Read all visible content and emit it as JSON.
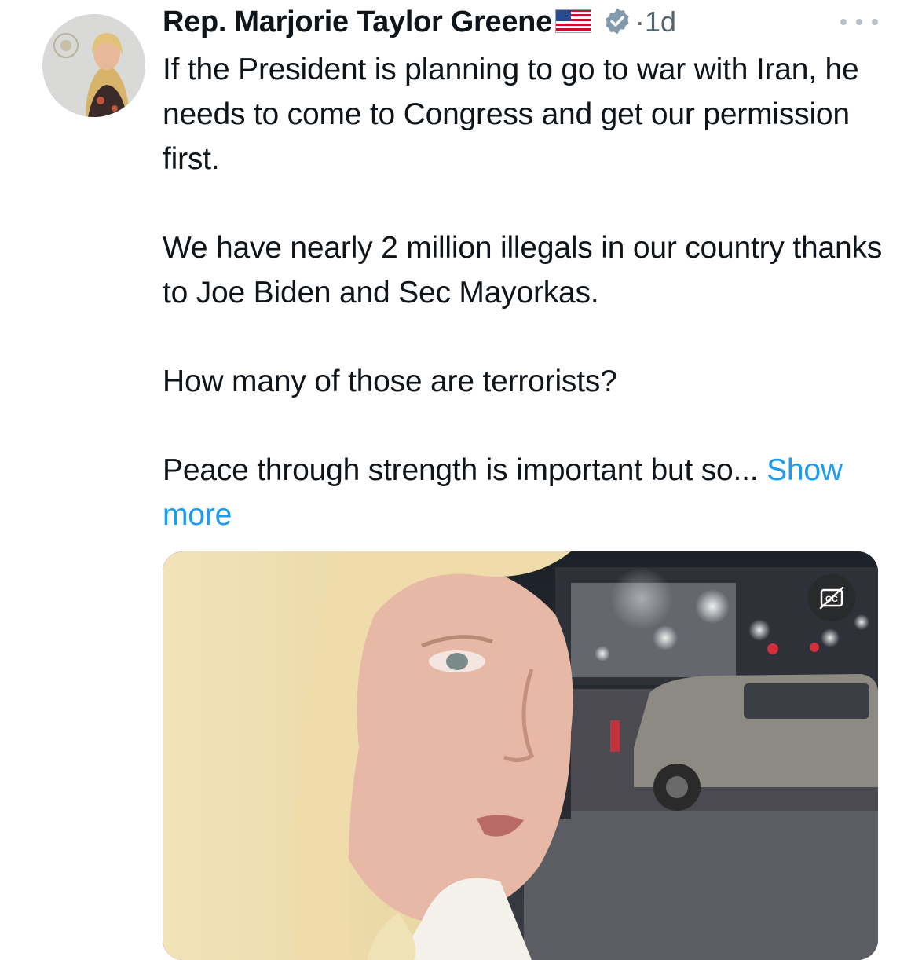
{
  "author": {
    "display_name": "Rep. Marjorie Taylor Greene",
    "flag": "us-flag-icon",
    "verified_icon": "verified-badge-icon",
    "separator": "·",
    "time": "1d"
  },
  "tweet": {
    "paragraphs": [
      "If the President is planning to go to war with Iran, he needs to come to Congress and get our permission first.",
      "We have nearly 2 million illegals in our country thanks to Joe Biden and Sec Mayorkas.",
      "How many of those are terrorists?",
      "Peace through strength is important but so..."
    ],
    "show_more_label": "Show more"
  },
  "media": {
    "type": "video",
    "captions_icon": "closed-captions-off-icon"
  },
  "icons": {
    "more": "more-options-icon"
  },
  "colors": {
    "text": "#0f1419",
    "secondary": "#536471",
    "link": "#1d9bf0"
  }
}
